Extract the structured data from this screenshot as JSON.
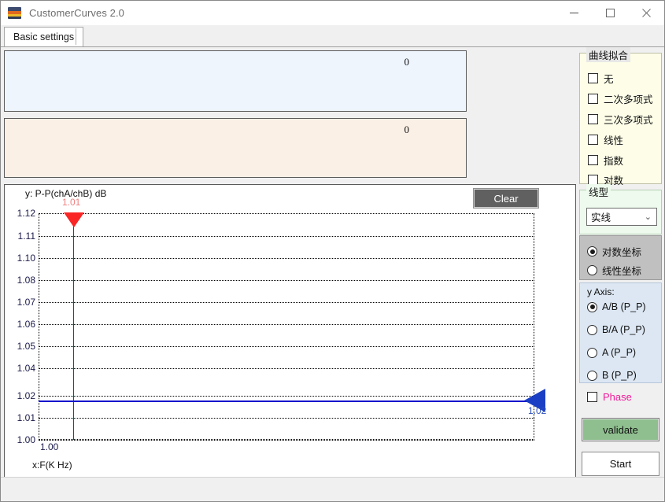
{
  "window": {
    "title": "CustomerCurves 2.0",
    "icon": "app-logo-icon",
    "minimize": "─",
    "maximize": "□",
    "close": "✕"
  },
  "tabs": [
    {
      "label": "Basic settings",
      "active": true
    }
  ],
  "panels": {
    "top": {
      "value": "0",
      "bg": "#eef5fd"
    },
    "bottom": {
      "value": "0",
      "bg": "#fbf0e6"
    }
  },
  "chart_area": {
    "y_axis_caption": "y: P-P(chA/chB) dB",
    "x_axis_caption": "x:F(K Hz)",
    "clear_button": "Clear"
  },
  "chart_data": {
    "type": "line",
    "title": "",
    "xlabel": "x:F(K Hz)",
    "ylabel": "y: P-P(chA/chB) dB",
    "grid": true,
    "x_ticks": [
      "1.00"
    ],
    "y_ticks": [
      "1.12",
      "1.11",
      "1.10",
      "1.08",
      "1.07",
      "1.06",
      "1.05",
      "1.04",
      "1.02",
      "1.01",
      "1.00"
    ],
    "ylim": [
      1.0,
      1.12
    ],
    "xlim": [
      1.0,
      1.0
    ],
    "series": [
      {
        "name": "cursor-marker-red",
        "orientation": "vertical",
        "value": 1.01,
        "label": "1.01",
        "color": "#dd0000",
        "marker": "triangle-down"
      },
      {
        "name": "level-marker-blue",
        "orientation": "horizontal",
        "value": 1.02,
        "label": "1.02",
        "color": "#1414cc",
        "marker": "triangle-left"
      }
    ]
  },
  "sidebar": {
    "curve_fit": {
      "title": "曲线拟合",
      "items": [
        {
          "label": "无",
          "checked": false
        },
        {
          "label": "二次多项式",
          "checked": false
        },
        {
          "label": "三次多项式",
          "checked": false
        },
        {
          "label": "线性",
          "checked": false
        },
        {
          "label": "指数",
          "checked": false
        },
        {
          "label": "对数",
          "checked": false
        }
      ]
    },
    "line_type": {
      "title": "线型",
      "selected": "实线",
      "caret": "⌄",
      "options": [
        "实线"
      ]
    },
    "coordinate": {
      "items": [
        {
          "label": "对数坐标",
          "selected": true
        },
        {
          "label": "线性坐标",
          "selected": false
        }
      ]
    },
    "y_axis": {
      "caption": "y Axis:",
      "items": [
        {
          "label": "A/B (P_P)",
          "selected": true
        },
        {
          "label": "B/A (P_P)",
          "selected": false
        },
        {
          "label": "A (P_P)",
          "selected": false
        },
        {
          "label": "B (P_P)",
          "selected": false
        }
      ]
    },
    "phase": {
      "label": "Phase",
      "checked": false,
      "color": "#f01a9a"
    },
    "validate_button": {
      "label": "validate",
      "color": "#8fbf8f"
    },
    "start_button": {
      "label": "Start"
    }
  }
}
